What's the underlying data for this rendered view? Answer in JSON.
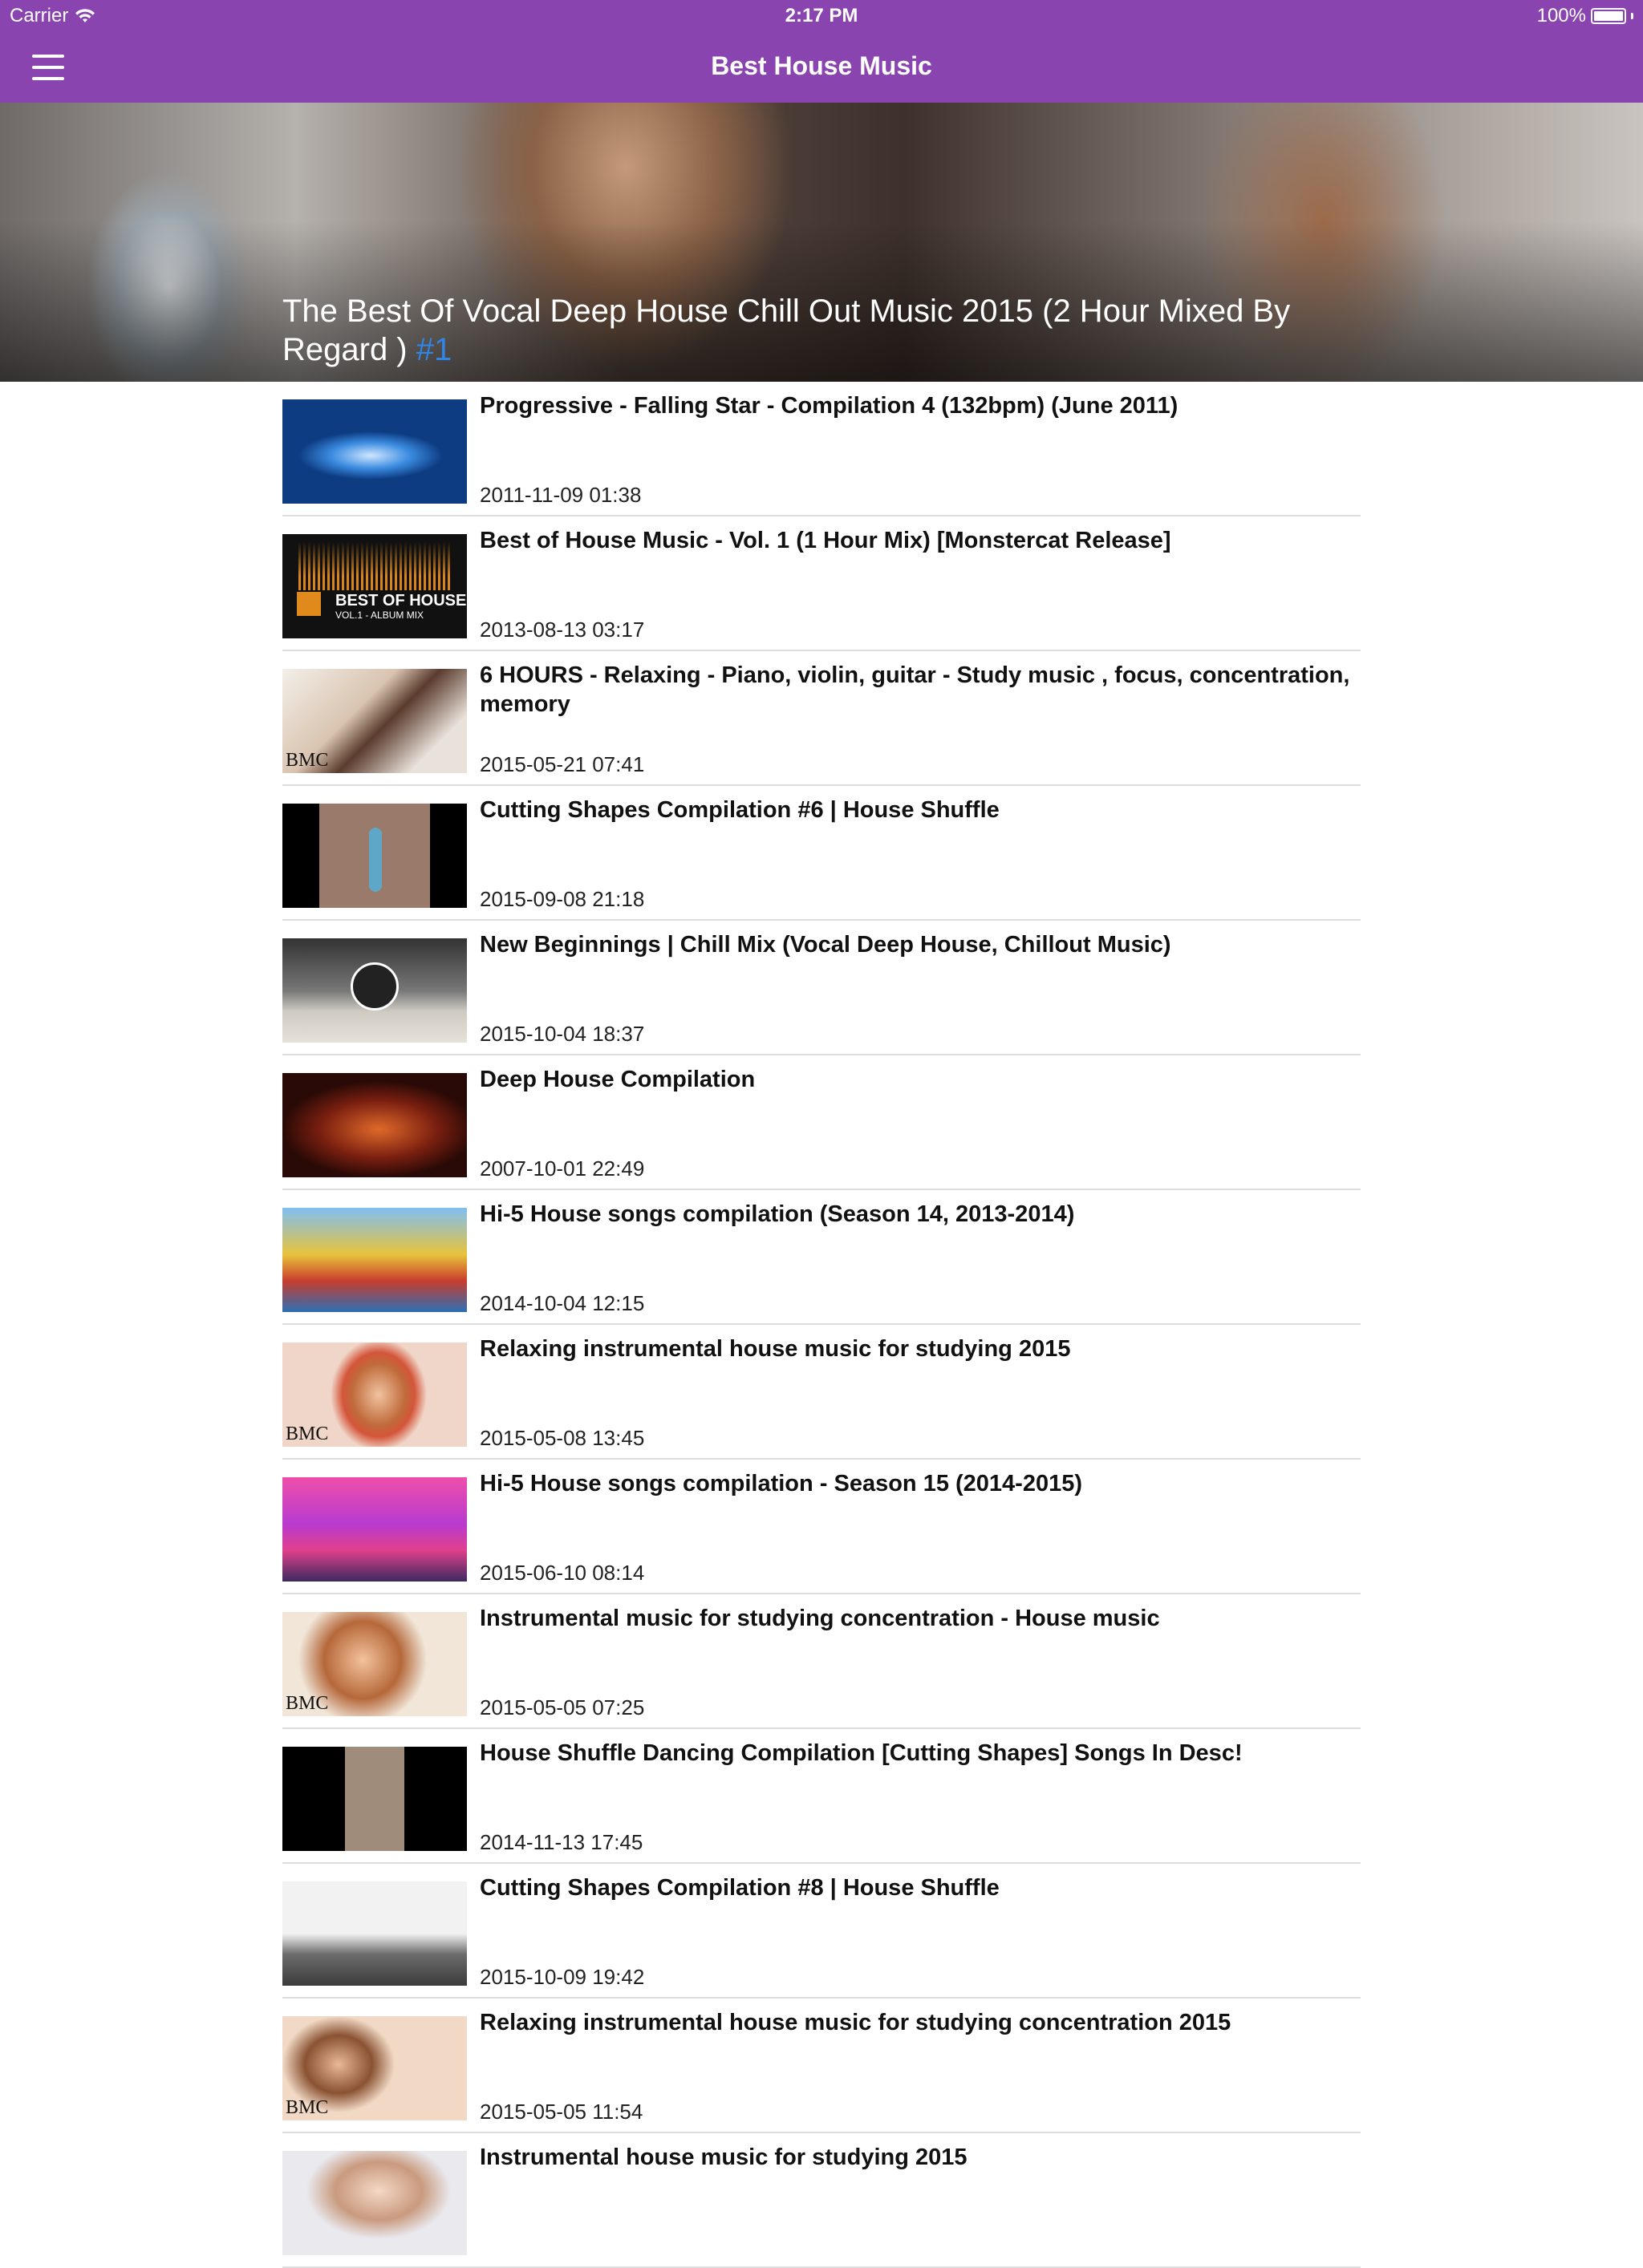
{
  "status_bar": {
    "carrier": "Carrier",
    "time": "2:17 PM",
    "battery": "100%",
    "battery_level": 1.0
  },
  "navbar": {
    "title": "Best House Music",
    "menu_icon": "hamburger-menu-icon",
    "background_color": "#8a44b0"
  },
  "hero": {
    "title": "The Best Of Vocal Deep House Chill Out Music 2015 (2 Hour Mixed By Regard )",
    "rank": "#1",
    "rank_color": "#2f86e8"
  },
  "videos": [
    {
      "title": "Progressive - Falling Star - Compilation 4 (132bpm)  (June 2011)",
      "date": "2011-11-09 01:38",
      "thumb_text": ""
    },
    {
      "title": "Best of House Music - Vol. 1 (1 Hour Mix) [Monstercat Release]",
      "date": "2013-08-13 03:17",
      "thumb_text": "BEST OF HOUSE",
      "thumb_subtext": "VOL.1 - ALBUM MIX"
    },
    {
      "title": "6 HOURS - Relaxing - Piano, violin, guitar -  Study music , focus, concentration, memory",
      "date": "2015-05-21 07:41",
      "thumb_text": "BMC"
    },
    {
      "title": "Cutting Shapes Compilation #6 | House Shuffle",
      "date": "2015-09-08 21:18",
      "thumb_text": ""
    },
    {
      "title": "New Beginnings | Chill Mix (Vocal Deep House, Chillout Music)",
      "date": "2015-10-04 18:37",
      "thumb_text": ""
    },
    {
      "title": "Deep House Compilation",
      "date": "2007-10-01 22:49",
      "thumb_text": ""
    },
    {
      "title": "Hi-5 House songs compilation (Season 14, 2013-2014)",
      "date": "2014-10-04 12:15",
      "thumb_text": ""
    },
    {
      "title": "Relaxing instrumental house music for studying 2015",
      "date": "2015-05-08 13:45",
      "thumb_text": "BMC"
    },
    {
      "title": "Hi-5 House songs compilation - Season 15 (2014-2015)",
      "date": "2015-06-10 08:14",
      "thumb_text": ""
    },
    {
      "title": "Instrumental music for studying concentration - House music",
      "date": "2015-05-05 07:25",
      "thumb_text": "BMC"
    },
    {
      "title": "House Shuffle Dancing Compilation [Cutting Shapes] Songs In Desc!",
      "date": "2014-11-13 17:45",
      "thumb_text": ""
    },
    {
      "title": "Cutting Shapes Compilation #8 | House Shuffle",
      "date": "2015-10-09 19:42",
      "thumb_text": ""
    },
    {
      "title": "Relaxing instrumental house music for studying concentration 2015",
      "date": "2015-05-05 11:54",
      "thumb_text": "BMC"
    },
    {
      "title": "Instrumental house music for studying 2015",
      "date": "",
      "thumb_text": ""
    }
  ]
}
